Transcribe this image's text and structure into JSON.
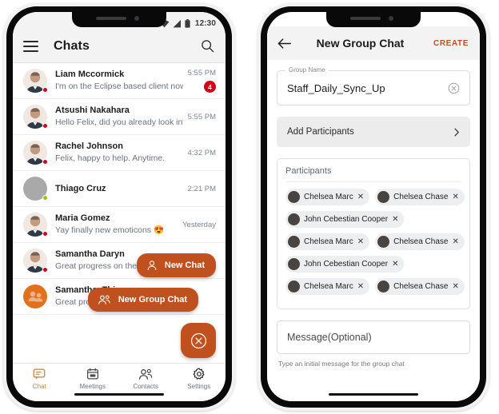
{
  "colors": {
    "accent": "#c0511f",
    "badge_red": "#d0021b",
    "presence_busy": "#d0021b",
    "presence_available": "#9ec11a",
    "nav_active": "#c0833f",
    "group_avatar": "#e2711d"
  },
  "left_phone": {
    "status_bar": {
      "time": "12:30",
      "icons": [
        "wifi-icon",
        "signal-icon",
        "battery-icon"
      ]
    },
    "app_bar": {
      "menu_icon": "hamburger-menu-icon",
      "title": "Chats",
      "search_icon": "search-icon"
    },
    "chats": [
      {
        "name": "Liam Mccormick",
        "message": "I'm on the Eclipse based client now",
        "time": "5:55 PM",
        "badge": "4",
        "presence": "busy",
        "avatar": "photo"
      },
      {
        "name": "Atsushi Nakahara",
        "message": "Hello Felix, did you already look into…",
        "time": "5:55 PM",
        "badge": "",
        "presence": "busy",
        "avatar": "photo"
      },
      {
        "name": "Rachel Johnson",
        "message": "Felix, happy to help. Anytime.",
        "time": "4:32 PM",
        "badge": "",
        "presence": "busy",
        "avatar": "photo"
      },
      {
        "name": "Thiago Cruz",
        "message": "",
        "time": "2:21 PM",
        "badge": "",
        "presence": "available",
        "avatar": "grey"
      },
      {
        "name": "Maria Gomez",
        "message": "Yay finally new emoticons 😍",
        "time": "Yesterday",
        "badge": "",
        "presence": "busy",
        "avatar": "photo"
      },
      {
        "name": "Samantha Daryn",
        "message": "Great progress on the Sametime…",
        "time": "",
        "badge": "",
        "presence": "busy",
        "avatar": "photo"
      },
      {
        "name": "Samantha, Thia…",
        "message": "Great progress on the Sametime…",
        "time": "",
        "badge": "",
        "presence": "none",
        "avatar": "group"
      }
    ],
    "fab": {
      "new_chat_label": "New Chat",
      "new_chat_icon": "person-icon",
      "new_group_chat_label": "New Group Chat",
      "new_group_chat_icon": "people-icon",
      "close_icon": "close-circle-icon"
    },
    "bottom_nav": [
      {
        "label": "Chat",
        "icon": "chat-bubble-icon",
        "active": true
      },
      {
        "label": "Meetings",
        "icon": "calendar-icon",
        "active": false
      },
      {
        "label": "Contacts",
        "icon": "contacts-icon",
        "active": false
      },
      {
        "label": "Settings",
        "icon": "gear-icon",
        "active": false
      }
    ]
  },
  "right_phone": {
    "app_bar": {
      "back_icon": "back-arrow-icon",
      "title": "New Group Chat",
      "create_label": "CREATE"
    },
    "group_name": {
      "legend": "Group Name",
      "value": "Staff_Daily_Sync_Up",
      "placeholder": "Group Name",
      "clear_icon": "clear-circle-icon"
    },
    "add_participants": {
      "label": "Add Participants",
      "chevron_icon": "chevron-right-icon"
    },
    "participants": {
      "title": "Participants",
      "rows": [
        [
          {
            "name": "Chelsea Marc",
            "remove_icon": "remove-x-icon"
          },
          {
            "name": "Chelsea Chase",
            "remove_icon": "remove-x-icon"
          }
        ],
        [
          {
            "name": "John Cebestian Cooper",
            "remove_icon": "remove-x-icon"
          }
        ],
        [
          {
            "name": "Chelsea Marc",
            "remove_icon": "remove-x-icon"
          },
          {
            "name": "Chelsea Chase",
            "remove_icon": "remove-x-icon"
          }
        ],
        [
          {
            "name": "John Cebestian Cooper",
            "remove_icon": "remove-x-icon"
          }
        ],
        [
          {
            "name": "Chelsea Marc",
            "remove_icon": "remove-x-icon"
          },
          {
            "name": "Chelsea Chase",
            "remove_icon": "remove-x-icon"
          }
        ]
      ]
    },
    "message": {
      "placeholder": "Message(Optional)",
      "value": "Message(Optional)",
      "helper": "Type an initial message for the group chat"
    }
  }
}
